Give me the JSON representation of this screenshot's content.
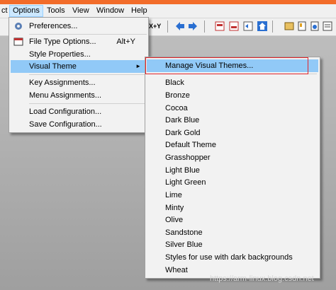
{
  "menubar": {
    "items": [
      {
        "label": "ct"
      },
      {
        "label": "Options"
      },
      {
        "label": "Tools"
      },
      {
        "label": "View"
      },
      {
        "label": "Window"
      },
      {
        "label": "Help"
      }
    ]
  },
  "toolbar": {
    "icons": [
      "cut-icon",
      "xy-icon",
      "back-arrow-icon",
      "forward-arrow-icon",
      "compare-left-icon",
      "compare-right-icon",
      "compare-mid-icon",
      "home-icon",
      "sync-icon",
      "bookmark-icon",
      "export-icon",
      "settings-icon",
      "report-icon"
    ],
    "xy_label": "X+Y"
  },
  "options_menu": {
    "items": [
      {
        "label": "Preferences...",
        "icon": "preferences-icon"
      },
      {
        "label": "File Type Options...",
        "shortcut": "Alt+Y",
        "icon": "file-type-icon"
      },
      {
        "label": "Style Properties..."
      },
      {
        "label": "Visual Theme",
        "submenu_arrow": "►"
      },
      {
        "label": "Key Assignments..."
      },
      {
        "label": "Menu Assignments..."
      },
      {
        "label": "Load Configuration..."
      },
      {
        "label": "Save Configuration..."
      }
    ]
  },
  "visual_theme_menu": {
    "items": [
      "Manage Visual Themes...",
      "Black",
      "Bronze",
      "Cocoa",
      "Dark Blue",
      "Dark Gold",
      "Default Theme",
      "Grasshopper",
      "Light Blue",
      "Light Green",
      "Lime",
      "Minty",
      "Olive",
      "Sandstone",
      "Silver Blue",
      "Styles for use with dark backgrounds",
      "Wheat"
    ]
  },
  "watermark": "https://arm-linux.blog.csdn.net",
  "colors": {
    "highlight": "#91c9f7",
    "callout": "#e0242b",
    "top_strip": "#f26c2a"
  }
}
